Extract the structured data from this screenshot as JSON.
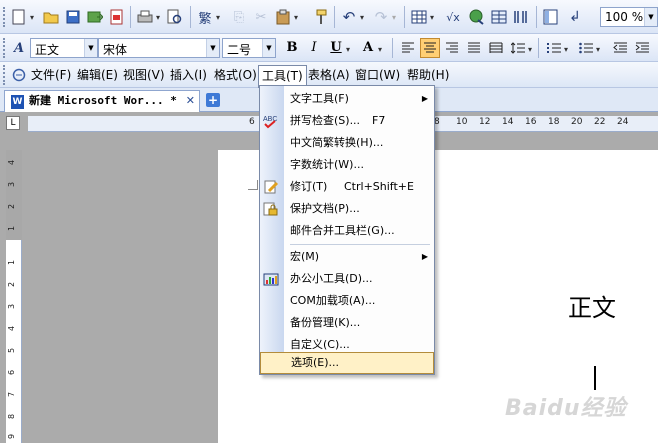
{
  "toolbar": {
    "zoom": "100 %"
  },
  "format": {
    "style": "正文",
    "font": "宋体",
    "size": "二号",
    "bold": "B",
    "italic": "I",
    "underline": "U",
    "font_color": "A"
  },
  "menubar": [
    {
      "label": "文件(F)"
    },
    {
      "label": "编辑(E)"
    },
    {
      "label": "视图(V)"
    },
    {
      "label": "插入(I)"
    },
    {
      "label": "格式(O)"
    },
    {
      "label": "工具(T)"
    },
    {
      "label": "表格(A)"
    },
    {
      "label": "窗口(W)"
    },
    {
      "label": "帮助(H)"
    }
  ],
  "tab": {
    "title": "新建 Microsoft Wor... *",
    "close": "✕",
    "new_tab": "+"
  },
  "ruler": {
    "corner": "L",
    "h_ticks": [
      "6",
      "8",
      "10",
      "12",
      "14",
      "16",
      "18",
      "20",
      "22",
      "24"
    ],
    "v_ticks": [
      "4",
      "3",
      "2",
      "1",
      "1",
      "2",
      "3",
      "4",
      "5",
      "6",
      "7",
      "8",
      "9"
    ]
  },
  "tools_menu": {
    "items": [
      {
        "label": "文字工具(F)",
        "shortcut": "",
        "submenu": true
      },
      {
        "label": "拼写检查(S)...",
        "shortcut": "F7",
        "icon": "spell-check-icon"
      },
      {
        "label": "中文简繁转换(H)...",
        "shortcut": ""
      },
      {
        "label": "字数统计(W)...",
        "shortcut": ""
      },
      {
        "label": "修订(T)",
        "shortcut": "Ctrl+Shift+E",
        "icon": "track-changes-icon"
      },
      {
        "label": "保护文档(P)...",
        "shortcut": "",
        "icon": "protect-document-icon"
      },
      {
        "label": "邮件合并工具栏(G)...",
        "shortcut": ""
      },
      {
        "label": "宏(M)",
        "shortcut": "",
        "submenu": true
      },
      {
        "label": "办公小工具(D)...",
        "shortcut": "",
        "icon": "office-tools-icon"
      },
      {
        "label": "COM加载项(A)...",
        "shortcut": ""
      },
      {
        "label": "备份管理(K)...",
        "shortcut": ""
      },
      {
        "label": "自定义(C)...",
        "shortcut": ""
      },
      {
        "label": "选项(E)...",
        "shortcut": "",
        "highlighted": true
      }
    ]
  },
  "document": {
    "text": "正文"
  },
  "watermark": "Baidu经验",
  "colors": {
    "toolbar_bg": "#dbe5f6",
    "menu_highlight": "#fff1c7",
    "active_button": "#ffcf74",
    "workspace": "#ababab"
  }
}
